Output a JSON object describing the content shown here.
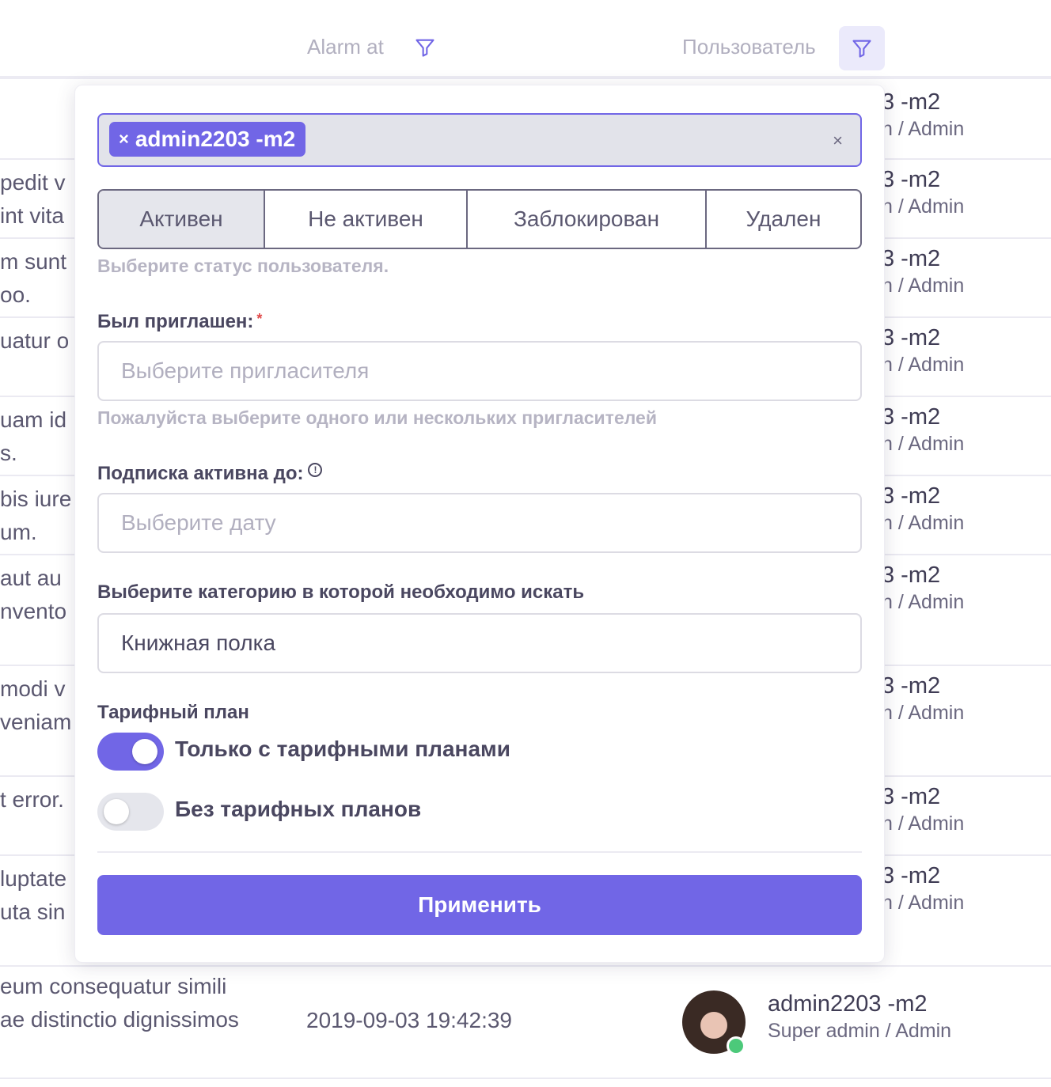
{
  "table": {
    "columns": {
      "alarm_at": "Alarm at",
      "user": "Пользователь"
    },
    "rows": [
      {
        "left": [
          "",
          ""
        ],
        "user_name": "3 -m2",
        "user_role": "n / Admin"
      },
      {
        "left": [
          "pedit v",
          "int vita"
        ],
        "user_name": "3 -m2",
        "user_role": "n / Admin"
      },
      {
        "left": [
          "m sunt",
          "oo."
        ],
        "user_name": "3 -m2",
        "user_role": "n / Admin"
      },
      {
        "left": [
          "uatur o",
          ""
        ],
        "user_name": "3 -m2",
        "user_role": "n / Admin"
      },
      {
        "left": [
          "uam id",
          "s."
        ],
        "user_name": "3 -m2",
        "user_role": "n / Admin"
      },
      {
        "left": [
          "bis iure",
          "um."
        ],
        "user_name": "3 -m2",
        "user_role": "n / Admin"
      },
      {
        "left": [
          "aut au",
          "nvento"
        ],
        "user_name": "3 -m2",
        "user_role": "n / Admin"
      },
      {
        "left": [
          "modi v",
          "veniam"
        ],
        "user_name": "3 -m2",
        "user_role": "n / Admin"
      },
      {
        "left": [
          "t error.",
          ""
        ],
        "user_name": "3 -m2",
        "user_role": "n / Admin"
      },
      {
        "left": [
          "luptate",
          "uta sin"
        ],
        "user_name": "3 -m2",
        "user_role": "n / Admin"
      },
      {
        "left": [
          "eum consequatur simili",
          "ae distinctio dignissimos"
        ],
        "date": "2019-09-03 19:42:39",
        "user_name": "admin2203 -m2",
        "user_role": "Super admin / Admin"
      }
    ]
  },
  "filter": {
    "selected_user_tag": "admin2203 -m2",
    "tag_remove_glyph": "×",
    "clear_glyph": "×",
    "status_options": [
      "Активен",
      "Не активен",
      "Заблокирован",
      "Удален"
    ],
    "status_active_index": 0,
    "status_hint": "Выберите статус пользователя.",
    "invited_label": "Был приглашен:",
    "required_mark": "*",
    "invited_placeholder": "Выберите пригласителя",
    "invited_hint": "Пожалуйста выберите одного или нескольких пригласителей",
    "subscription_label": "Подписка активна до:",
    "info_glyph": "!",
    "subscription_placeholder": "Выберите дату",
    "category_label": "Выберите категорию в которой необходимо искать",
    "category_value": "Книжная полка",
    "plan_label": "Тарифный план",
    "toggle_with_plans": {
      "label": "Только с тарифными планами",
      "on": true
    },
    "toggle_without_plans": {
      "label": "Без тарифных планов",
      "on": false
    },
    "apply_label": "Применить"
  },
  "colors": {
    "accent": "#7166e6",
    "online": "#4cc97a"
  },
  "icons": {
    "column_filter": "funnel-icon",
    "status": "online-indicator"
  }
}
